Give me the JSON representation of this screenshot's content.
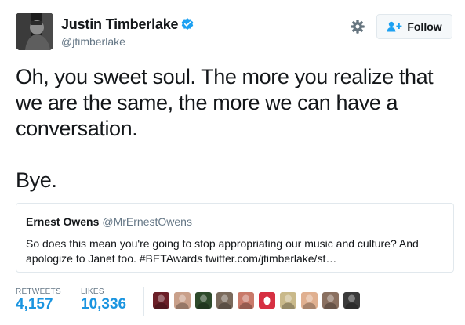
{
  "author": {
    "display_name": "Justin Timberlake",
    "handle": "@jtimberlake",
    "avatar_icon": "avatar-photo",
    "verified_icon": "verified-badge-icon",
    "verified_color": "#1da1f2"
  },
  "actions": {
    "settings_icon": "gear-icon",
    "follow_label": "Follow",
    "follow_icon": "person-add-icon"
  },
  "tweet": {
    "line1": "Oh, you sweet soul. The more you realize that",
    "line2": "we are the same, the more we can have a",
    "line3": "conversation.",
    "line4": "Bye."
  },
  "quote": {
    "name": "Ernest Owens",
    "handle": "@MrErnestOwens",
    "line1": "So does this mean you're going to stop appropriating our music and culture? And",
    "line2": "apologize to Janet too. #BETAwards twitter.com/jtimberlake/st…"
  },
  "stats": {
    "retweets_label": "RETWEETS",
    "retweets_value": "4,157",
    "likes_label": "LIKES",
    "likes_value": "10,336",
    "accent_color": "#1b95e0"
  },
  "likers": [
    {
      "name": "liker-avatar-1",
      "color": "#6b1f28"
    },
    {
      "name": "liker-avatar-2",
      "color": "#c9a08a"
    },
    {
      "name": "liker-avatar-3",
      "color": "#2e4a2b"
    },
    {
      "name": "liker-avatar-4",
      "color": "#7a6a5c"
    },
    {
      "name": "liker-avatar-5",
      "color": "#c97a6a"
    },
    {
      "name": "liker-avatar-6",
      "color": "#d63042"
    },
    {
      "name": "liker-avatar-7",
      "color": "#c9b98a"
    },
    {
      "name": "liker-avatar-8",
      "color": "#e0b090"
    },
    {
      "name": "liker-avatar-9",
      "color": "#8a7060"
    },
    {
      "name": "liker-avatar-10",
      "color": "#3a3a3a"
    }
  ]
}
